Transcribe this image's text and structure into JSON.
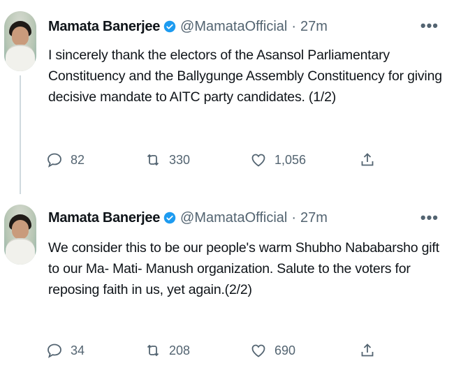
{
  "tweets": [
    {
      "author_name": "Mamata Banerjee",
      "handle": "@MamataOfficial",
      "separator": "·",
      "time": "27m",
      "more": "•••",
      "text": "I sincerely thank the electors of the Asansol Parliamentary Constituency and the Ballygunge Assembly Constituency for giving decisive mandate to AITC party candidates. (1/2)",
      "replies": "82",
      "retweets": "330",
      "likes": "1,056"
    },
    {
      "author_name": "Mamata Banerjee",
      "handle": "@MamataOfficial",
      "separator": "·",
      "time": "27m",
      "more": "•••",
      "text": "We consider this to be our people's warm Shubho Nababarsho gift to our Ma- Mati- Manush organization. Salute to the voters for reposing faith in us, yet again.(2/2)",
      "replies": "34",
      "retweets": "208",
      "likes": "690"
    }
  ],
  "colors": {
    "text": "#0f1419",
    "secondary": "#536471",
    "verified": "#1d9bf0",
    "thread_line": "#cfd9de"
  },
  "icons": [
    "reply-icon",
    "retweet-icon",
    "like-icon",
    "share-icon",
    "verified-badge-icon",
    "more-icon"
  ]
}
